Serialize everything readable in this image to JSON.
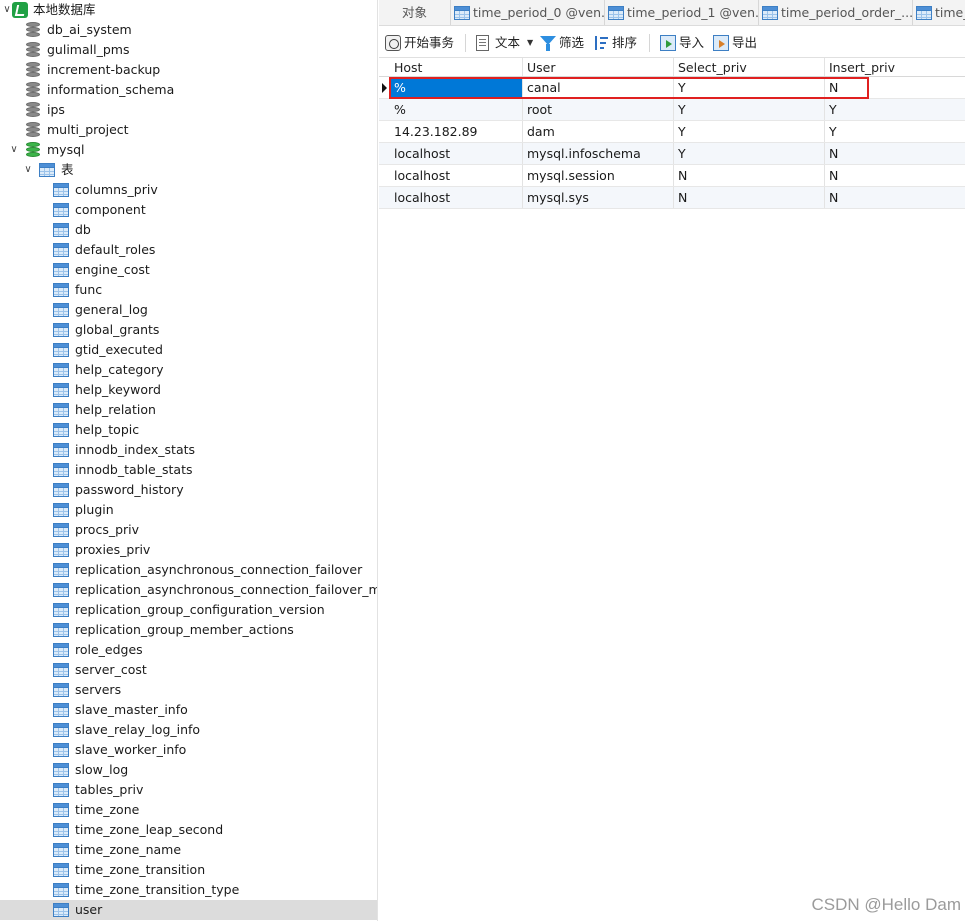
{
  "nav": {
    "connection": "本地数据库",
    "databases": [
      "db_ai_system",
      "gulimall_pms",
      "increment-backup",
      "information_schema",
      "ips",
      "multi_project"
    ],
    "open_database": "mysql",
    "tables_folder": "表",
    "tables": [
      "columns_priv",
      "component",
      "db",
      "default_roles",
      "engine_cost",
      "func",
      "general_log",
      "global_grants",
      "gtid_executed",
      "help_category",
      "help_keyword",
      "help_relation",
      "help_topic",
      "innodb_index_stats",
      "innodb_table_stats",
      "password_history",
      "plugin",
      "procs_priv",
      "proxies_priv",
      "replication_asynchronous_connection_failover",
      "replication_asynchronous_connection_failover_manag",
      "replication_group_configuration_version",
      "replication_group_member_actions",
      "role_edges",
      "server_cost",
      "servers",
      "slave_master_info",
      "slave_relay_log_info",
      "slave_worker_info",
      "slow_log",
      "tables_priv",
      "time_zone",
      "time_zone_leap_second",
      "time_zone_name",
      "time_zone_transition",
      "time_zone_transition_type",
      "user"
    ],
    "selected_table": "user"
  },
  "tabs": [
    "对象",
    "time_period_0 @ven...",
    "time_period_1 @ven...",
    "time_period_order_...",
    "time_"
  ],
  "toolbar": {
    "begin_transaction": "开始事务",
    "text": "文本",
    "filter": "筛选",
    "sort": "排序",
    "import": "导入",
    "export": "导出"
  },
  "grid": {
    "columns": [
      "Host",
      "User",
      "Select_priv",
      "Insert_priv"
    ],
    "rows": [
      [
        "%",
        "canal",
        "Y",
        "N"
      ],
      [
        "%",
        "root",
        "Y",
        "Y"
      ],
      [
        "14.23.182.89",
        "dam",
        "Y",
        "Y"
      ],
      [
        "localhost",
        "mysql.infoschema",
        "Y",
        "N"
      ],
      [
        "localhost",
        "mysql.session",
        "N",
        "N"
      ],
      [
        "localhost",
        "mysql.sys",
        "N",
        "N"
      ]
    ]
  },
  "watermark": "CSDN @Hello Dam",
  "colors": {
    "selection": "#0078d7",
    "highlight_box": "#e02020",
    "db_open": "#3cb54a"
  }
}
